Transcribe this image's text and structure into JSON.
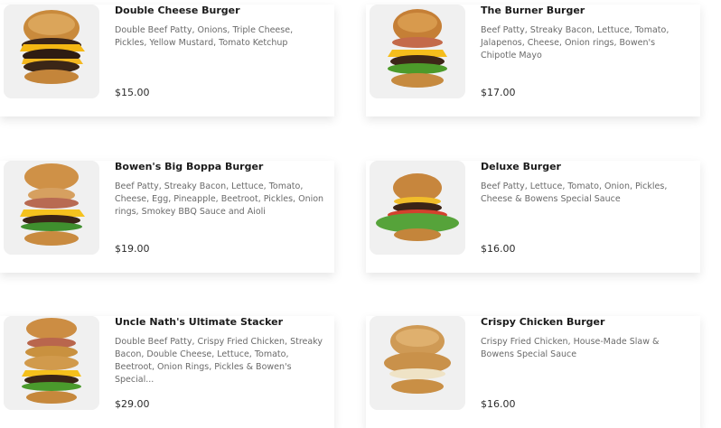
{
  "menu": {
    "items": [
      {
        "name": "Double Cheese Burger",
        "description": "Double Beef Patty, Onions, Triple Cheese, Pickles, Yellow Mustard, Tomato Ketchup",
        "price": "$15.00"
      },
      {
        "name": "The Burner Burger",
        "description": "Beef Patty, Streaky Bacon, Lettuce, Tomato, Jalapenos, Cheese, Onion rings, Bowen's Chipotle Mayo",
        "price": "$17.00"
      },
      {
        "name": "Bowen's Big Boppa Burger",
        "description": "Beef Patty, Streaky Bacon, Lettuce, Tomato, Cheese, Egg, Pineapple, Beetroot, Pickles, Onion rings, Smokey BBQ Sauce and Aioli",
        "price": "$19.00"
      },
      {
        "name": "Deluxe Burger",
        "description": "Beef Patty, Lettuce, Tomato, Onion, Pickles, Cheese & Bowens Special Sauce",
        "price": "$16.00"
      },
      {
        "name": "Uncle Nath's Ultimate Stacker",
        "description": "Double Beef Patty, Crispy Fried Chicken, Streaky Bacon, Double Cheese, Lettuce, Tomato, Beetroot, Onion Rings, Pickles & Bowen's Special...",
        "price": "$29.00"
      },
      {
        "name": "Crispy Chicken Burger",
        "description": "Crispy Fried Chicken, House-Made Slaw & Bowens Special Sauce",
        "price": "$16.00"
      }
    ]
  }
}
